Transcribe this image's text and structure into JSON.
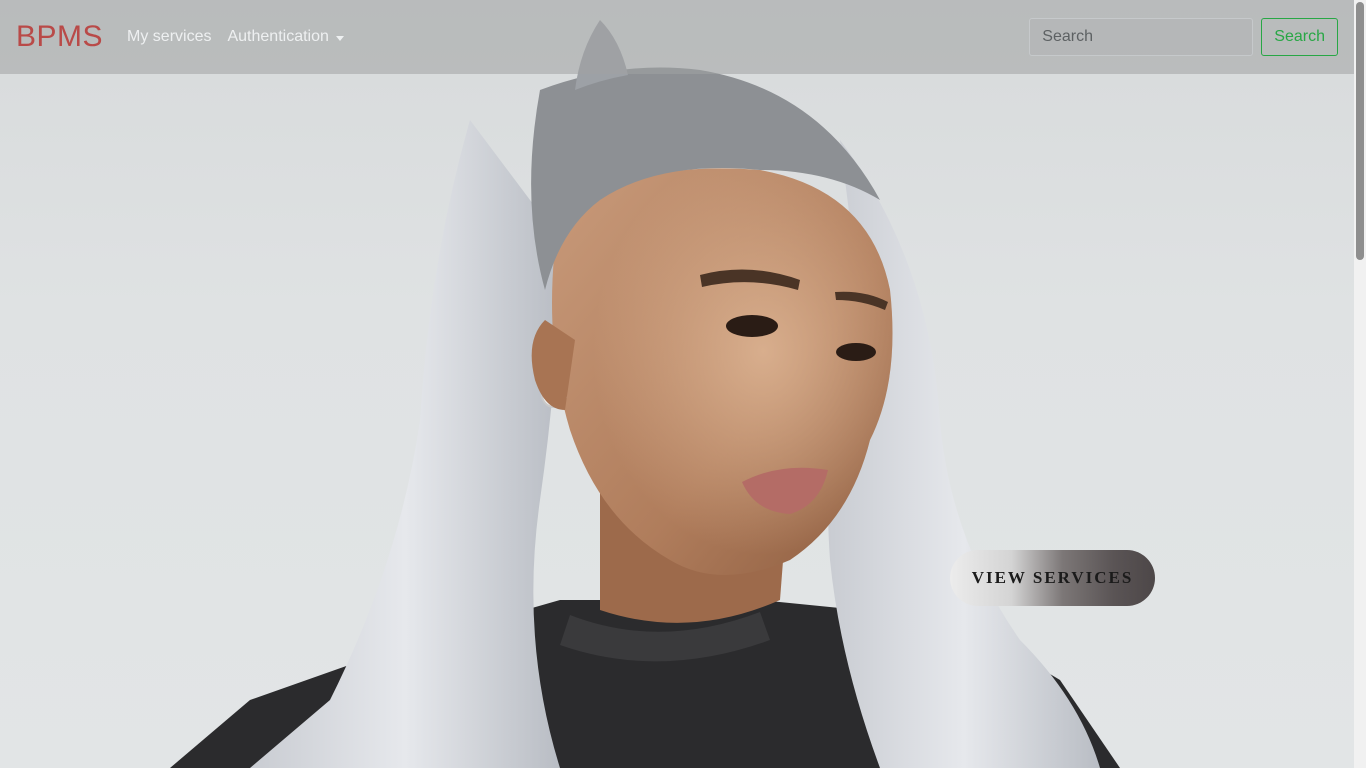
{
  "navbar": {
    "brand": "BPMS",
    "links": {
      "my_services": "My services",
      "authentication": "Authentication"
    },
    "search": {
      "placeholder": "Search",
      "button_label": "Search"
    }
  },
  "hero": {
    "cta_label": "VIEW SERVICES"
  },
  "colors": {
    "brand": "#b94a48",
    "accent_green": "#28a745",
    "navbar_text": "#eef0f1"
  },
  "icons": {
    "dropdown": "chevron-down-icon"
  }
}
